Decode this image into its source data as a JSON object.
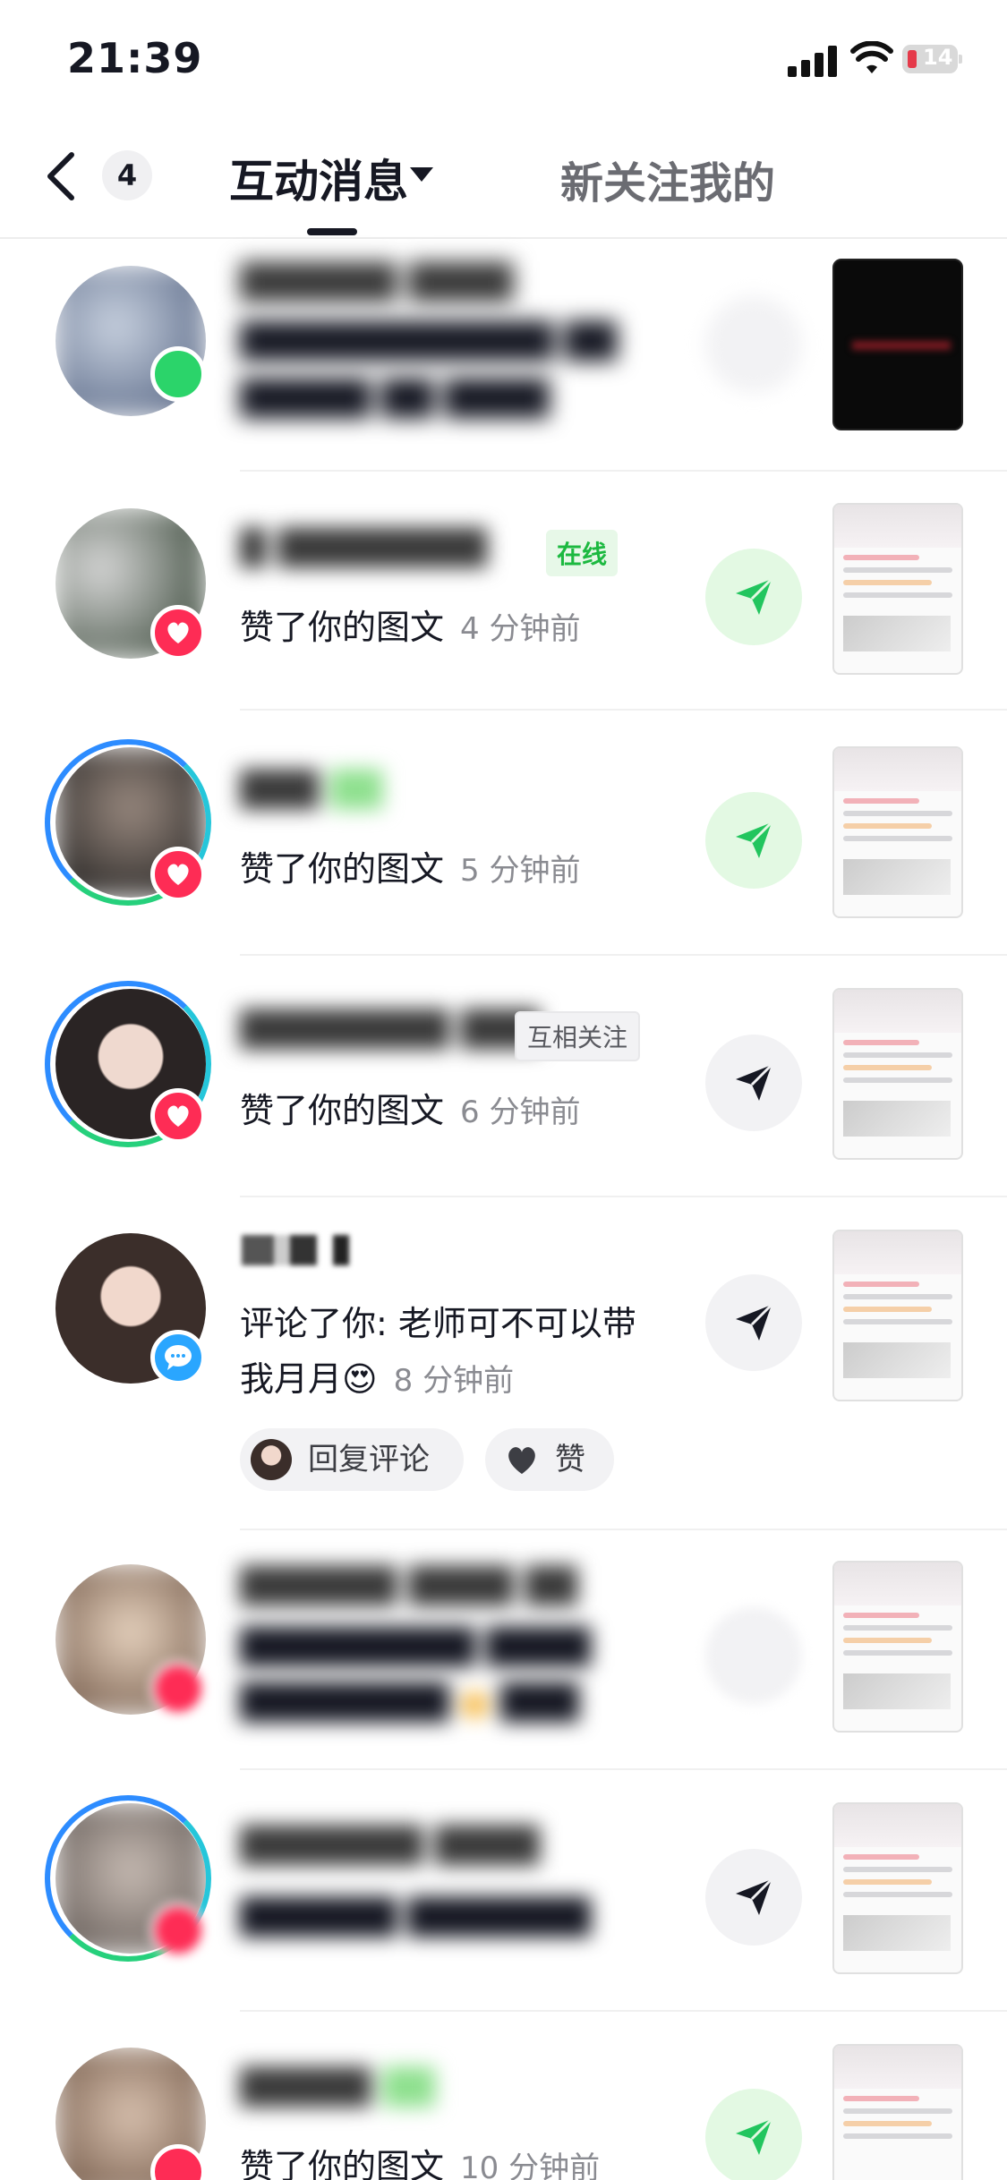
{
  "status_bar": {
    "time": "21:39",
    "battery": "14"
  },
  "header": {
    "back_count": "4",
    "tab_active": "互动消息",
    "tab_other": "新关注我的"
  },
  "colors": {
    "accent_green": "#22c55e",
    "like_red": "#fe2c55",
    "comment_blue": "#2aa6ff"
  },
  "items": [
    {
      "name": "",
      "tag": "",
      "action": "",
      "time": "",
      "share_green": false,
      "badge": "green"
    },
    {
      "name": "",
      "tag": "在线",
      "action": "赞了你的图文",
      "time": "4 分钟前",
      "share_green": true,
      "badge": "like-heart-icon"
    },
    {
      "name": "",
      "tag": "",
      "action": "赞了你的图文",
      "time": "5 分钟前",
      "share_green": true,
      "badge": "like-heart-icon"
    },
    {
      "name": "",
      "tag": "互相关注",
      "action": "赞了你的图文",
      "time": "6 分钟前",
      "share_green": false,
      "badge": "like-heart-icon"
    },
    {
      "name": "",
      "tag": "",
      "action_line1": "评论了你: 老师可不可以带",
      "action_line2": "我月月",
      "time": "8 分钟前",
      "share_green": false,
      "badge": "comment-icon",
      "reply_label": "回复评论",
      "like_label": "赞"
    },
    {
      "name": "",
      "tag": "",
      "action": "",
      "time": "",
      "share_green": false,
      "badge": "like-heart-icon"
    },
    {
      "name": "",
      "tag": "",
      "action": "",
      "time": "",
      "share_green": false,
      "badge": "like-heart-icon"
    },
    {
      "name": "",
      "tag": "",
      "action": "赞了你的图文",
      "time": "10 分钟前",
      "share_green": true,
      "badge": "like-heart-icon"
    }
  ]
}
